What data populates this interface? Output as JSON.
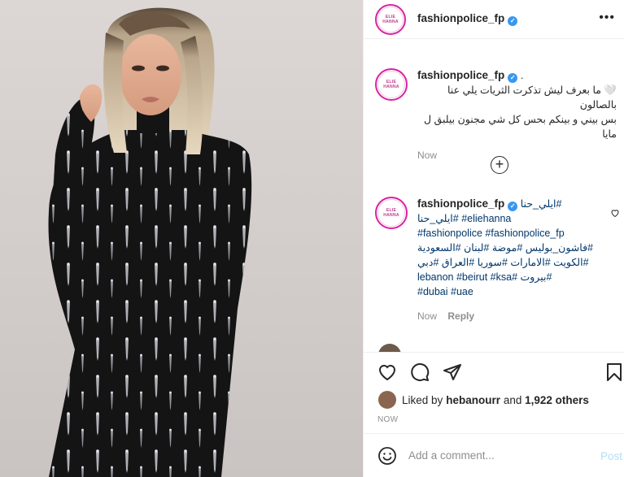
{
  "post": {
    "photo": "woman-in-black-crystal-jumpsuit",
    "author": "fashionpolice_fp",
    "avatar_text": "ELIE HANNA"
  },
  "header": {
    "username": "fashionpolice_fp",
    "more_label": "•••"
  },
  "caption": {
    "username": "fashionpolice_fp",
    "suffix": " .",
    "line1": "🤍 ما بعرف ليش تذكرت الثريات يلي عنا بالصالون",
    "line2": "بس بيني و بينكم بحس كل شي مجنون بيلبق ل مايا",
    "time": "Now"
  },
  "load_more": {
    "label": "+"
  },
  "comment": {
    "username": "fashionpolice_fp",
    "line1": "#ايلي_حنا",
    "line2a": "#ايلي_حنا",
    "line2b": "#eliehanna",
    "line3": "#fashionpolice #fashionpolice_fp",
    "line4": "#فاشون_بوليس #موضة #لبنان #السعودية",
    "line5": "#الكويت #الامارات #سوريا #العراق #دبي",
    "line6": "#بيروت #lebanon #beirut #ksa",
    "line7": "#dubai #uae",
    "time": "Now",
    "reply": "Reply"
  },
  "likes": {
    "prefix": "Liked by ",
    "user": "hebanourr",
    "middle": " and ",
    "count": "1,922 others"
  },
  "timestamp": "NOW",
  "add_comment": {
    "placeholder": "Add a comment...",
    "post": "Post"
  },
  "colors": {
    "verified": "#3897f0",
    "link": "#00376b",
    "post_button": "#b2dffc",
    "muted": "#8e8e8e"
  }
}
